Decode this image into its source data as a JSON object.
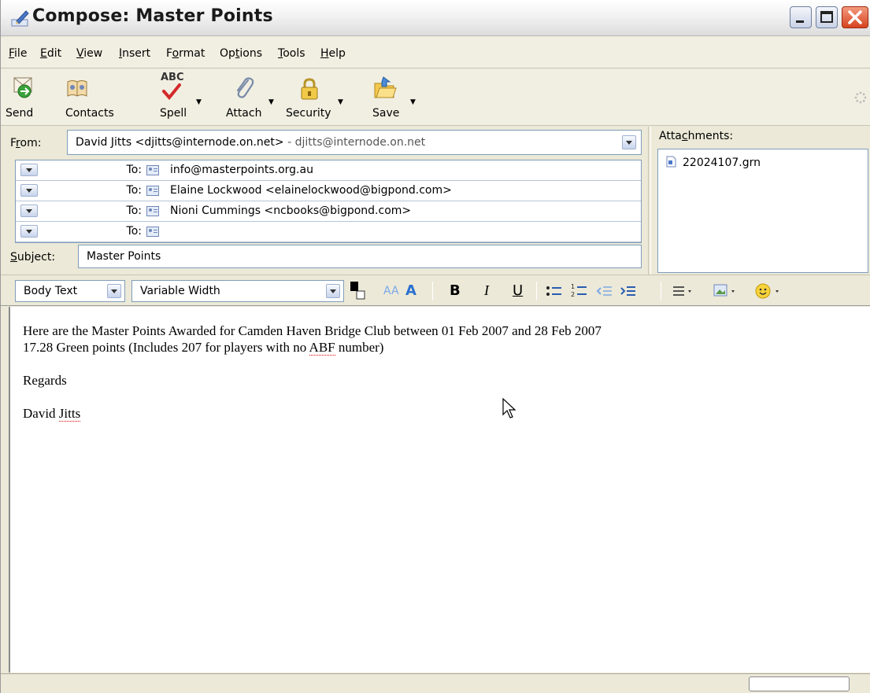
{
  "window": {
    "title": "Compose: Master Points"
  },
  "menu": [
    {
      "label": "File",
      "accel": "F",
      "rest": "ile"
    },
    {
      "label": "Edit",
      "accel": "E",
      "rest": "dit"
    },
    {
      "label": "View",
      "accel": "V",
      "rest": "iew"
    },
    {
      "label": "Insert",
      "accel": "I",
      "rest": "nsert"
    },
    {
      "label": "Format",
      "pre": "F",
      "accel": "o",
      "rest": "rmat"
    },
    {
      "label": "Options",
      "pre": "Op",
      "accel": "t",
      "rest": "ions"
    },
    {
      "label": "Tools",
      "accel": "T",
      "rest": "ools"
    },
    {
      "label": "Help",
      "accel": "H",
      "rest": "elp"
    }
  ],
  "toolbar": {
    "send": "Send",
    "contacts": "Contacts",
    "spell": "Spell",
    "attach": "Attach",
    "security": "Security",
    "save": "Save",
    "spell_icon_text": "ABC"
  },
  "header": {
    "from_label_pre": "F",
    "from_label_accel": "r",
    "from_label_rest": "om:",
    "from_value": "David Jitts <djitts@internode.on.net>",
    "from_secondary": "  - djitts@internode.on.net",
    "to_label": "To:",
    "recipients": [
      "info@masterpoints.org.au",
      "Elaine Lockwood <elainelockwood@bigpond.com>",
      "Nioni Cummings <ncbooks@bigpond.com>",
      ""
    ],
    "subject_label_accel": "S",
    "subject_label_rest": "ubject:",
    "subject_value": "Master Points",
    "attachments_label_pre": "Atta",
    "attachments_label_accel": "c",
    "attachments_label_rest": "hments:",
    "attachments": [
      "22024107.grn"
    ]
  },
  "format": {
    "paragraph_style": "Body Text",
    "font": "Variable Width"
  },
  "body": {
    "line1": "Here are the Master Points Awarded for Camden Haven Bridge Club between 01 Feb 2007 and 28 Feb 2007",
    "line2_pre": "17.28 Green points (Includes 207 for players with no ",
    "line2_flag": "ABF",
    "line2_post": " number)",
    "line3": "Regards",
    "line4_pre": "David ",
    "line4_flag": "Jitts"
  },
  "colors": {
    "accent": "#2a5db0",
    "close_button": "#d6431f",
    "field_border": "#7f9db9",
    "spell_underline": "#dd0000"
  }
}
